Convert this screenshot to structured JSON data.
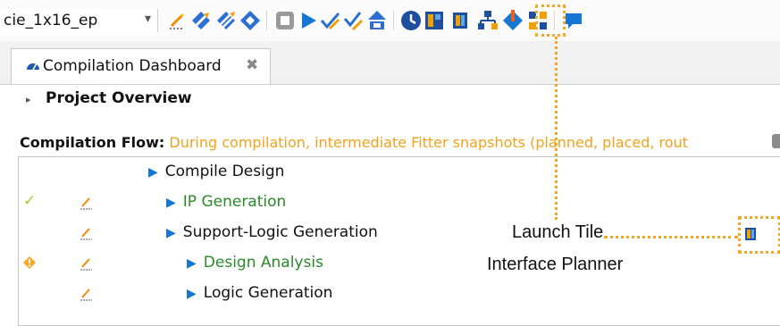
{
  "toolbar": {
    "project_name": "cie_1x16_ep",
    "icons": [
      "edit-icon",
      "compile-icon",
      "compile-multi-icon",
      "analysis-icon",
      "stop-icon",
      "start-icon",
      "check-icon",
      "check-edit-icon",
      "program-icon",
      "timing-icon",
      "chip-planner-icon",
      "tile-interface-planner-icon",
      "hierarchy-icon",
      "pin-planner-icon",
      "netlist-icon",
      "comment-icon"
    ]
  },
  "tabs": [
    {
      "label": "Compilation Dashboard",
      "close": "✖"
    }
  ],
  "overview": {
    "label": "Project Overview"
  },
  "flow": {
    "label": "Compilation Flow:",
    "message": "During compilation, intermediate Fitter snapshots (planned, placed, rout"
  },
  "tasks": [
    {
      "label": "Compile Design",
      "status": "",
      "color": "#111111"
    },
    {
      "label": "IP Generation",
      "status": "check",
      "color": "#2a8a2a"
    },
    {
      "label": "Support-Logic Generation",
      "status": "",
      "color": "#111111"
    },
    {
      "label": "Design Analysis",
      "status": "warning",
      "color": "#2a8a2a"
    },
    {
      "label": "Logic Generation",
      "status": "",
      "color": "#111111"
    }
  ],
  "callouts": {
    "line1": "Launch Tile",
    "line2": "Interface Planner"
  },
  "colors": {
    "accent": "#1677d2",
    "highlight": "#f5a623",
    "success": "#2a8a2a",
    "warning_text": "#f2a21c"
  }
}
